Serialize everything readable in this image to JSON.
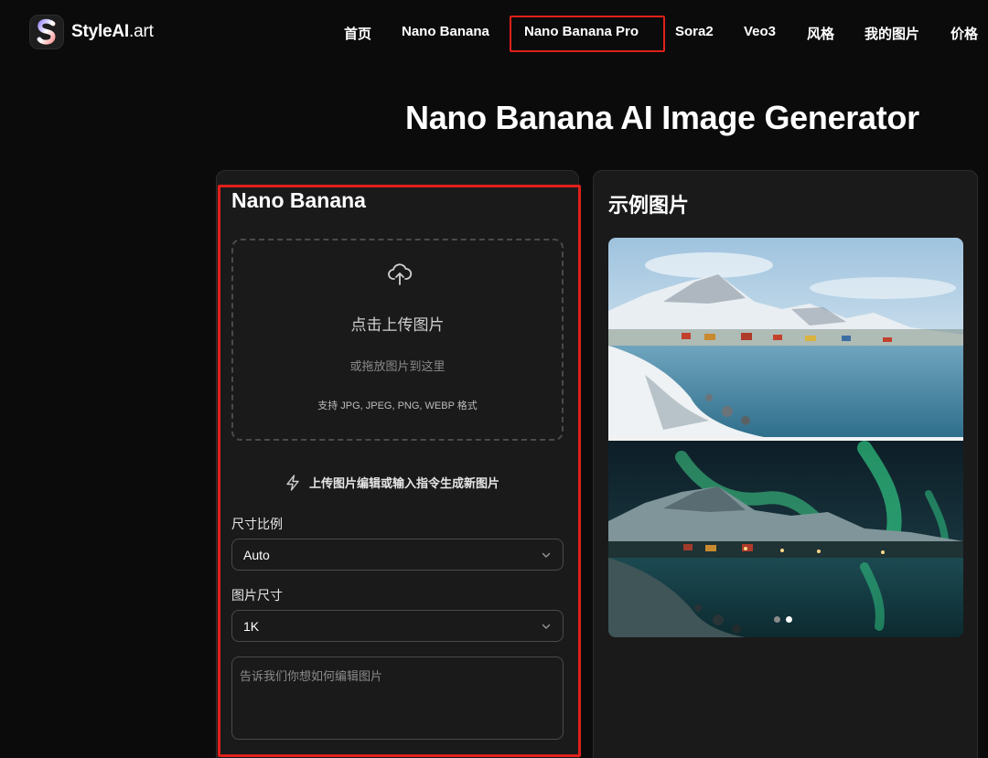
{
  "logo": {
    "name": "StyleAI",
    "suffix": ".art",
    "mark_letter": "S"
  },
  "nav": {
    "items": [
      {
        "label": "首页"
      },
      {
        "label": "Nano Banana"
      },
      {
        "label": "Nano Banana Pro"
      },
      {
        "label": "Sora2"
      },
      {
        "label": "Veo3"
      },
      {
        "label": "风格"
      },
      {
        "label": "我的图片"
      },
      {
        "label": "价格"
      }
    ],
    "highlighted_item": "Nano Banana Pro"
  },
  "page_title": "Nano Banana AI Image Generator",
  "form": {
    "title": "Nano Banana",
    "upload": {
      "title": "点击上传图片",
      "subtitle": "或拖放图片到这里",
      "formats": "支持 JPG, JPEG, PNG, WEBP 格式",
      "icon": "cloud-upload-icon"
    },
    "hint": "上传图片编辑或输入指令生成新图片",
    "aspect_ratio": {
      "label": "尺寸比例",
      "value": "Auto"
    },
    "image_size": {
      "label": "图片尺寸",
      "value": "1K"
    },
    "prompt": {
      "placeholder": "告诉我们你想如何编辑图片",
      "value": ""
    }
  },
  "examples": {
    "title": "示例图片",
    "carousel": {
      "count": 2,
      "active_index": 1
    }
  },
  "colors": {
    "background": "#0b0b0b",
    "panel": "#1a1a1a",
    "highlight_border": "#e0201b",
    "text": "#ffffff"
  }
}
